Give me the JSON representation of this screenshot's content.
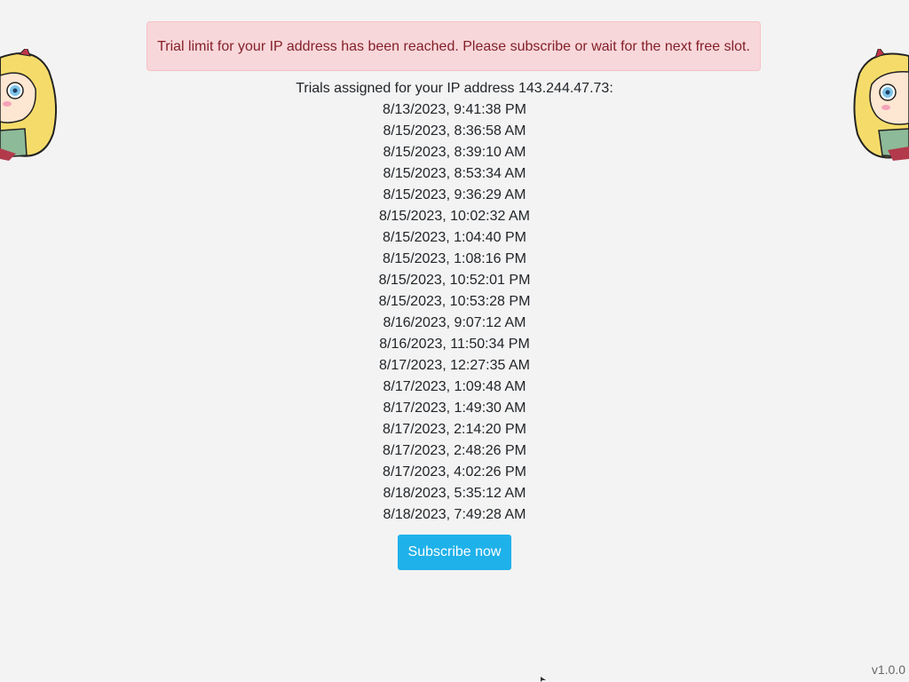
{
  "alert": {
    "message": "Trial limit for your IP address has been reached. Please subscribe or wait for the next free slot."
  },
  "trials": {
    "heading": "Trials assigned for your IP address 143.244.47.73:",
    "items": [
      "8/13/2023, 9:41:38 PM",
      "8/15/2023, 8:36:58 AM",
      "8/15/2023, 8:39:10 AM",
      "8/15/2023, 8:53:34 AM",
      "8/15/2023, 9:36:29 AM",
      "8/15/2023, 10:02:32 AM",
      "8/15/2023, 1:04:40 PM",
      "8/15/2023, 1:08:16 PM",
      "8/15/2023, 10:52:01 PM",
      "8/15/2023, 10:53:28 PM",
      "8/16/2023, 9:07:12 AM",
      "8/16/2023, 11:50:34 PM",
      "8/17/2023, 12:27:35 AM",
      "8/17/2023, 1:09:48 AM",
      "8/17/2023, 1:49:30 AM",
      "8/17/2023, 2:14:20 PM",
      "8/17/2023, 2:48:26 PM",
      "8/17/2023, 4:02:26 PM",
      "8/18/2023, 5:35:12 AM",
      "8/18/2023, 7:49:28 AM"
    ]
  },
  "actions": {
    "subscribe_label": "Subscribe now"
  },
  "footer": {
    "version": "v1.0.0"
  },
  "decorations": {
    "mascot_icon": "cartoon-girl-mascot-icon"
  },
  "colors": {
    "alert_bg": "#f8d7da",
    "alert_text": "#842029",
    "button_bg": "#1fb1e9",
    "page_bg": "#f3f3f3"
  }
}
